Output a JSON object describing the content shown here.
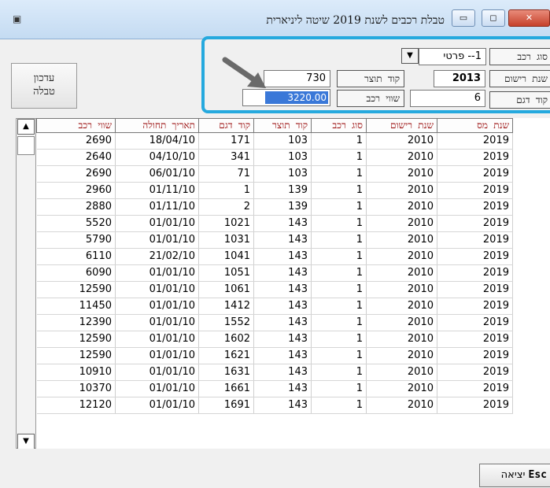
{
  "window": {
    "title": "טבלת רכבים לשנת 2019 שיטה ליניארית",
    "icon": "app-icon",
    "min_label": "▭",
    "max_label": "◻",
    "close_label": "✕"
  },
  "toolbar": {
    "refresh_label": "עדכון\nטבלה",
    "esc_label_key": "Esc",
    "esc_label_text": "יציאה"
  },
  "form": {
    "car_type_label": "סוג רכב",
    "car_type_value": "1-- פרטי",
    "reg_year_label": "שנת רישום",
    "reg_year_value": "2013",
    "model_code_label": "קוד דגם",
    "model_code_value": "6",
    "manufacturer_label": "קוד תוצר",
    "manufacturer_value": "730",
    "car_value_label": "שווי רכב",
    "car_value_value": "3220.00"
  },
  "table": {
    "headers": [
      "שווי רכב",
      "תאריך תחולה",
      "קוד דגם",
      "קוד תוצר",
      "סוג רכב",
      "שנת רישום",
      "שנת מס"
    ],
    "rows": [
      [
        "2690",
        "18/04/10",
        "171",
        "103",
        "1",
        "2010",
        "2019"
      ],
      [
        "2640",
        "04/10/10",
        "341",
        "103",
        "1",
        "2010",
        "2019"
      ],
      [
        "2690",
        "06/01/10",
        "71",
        "103",
        "1",
        "2010",
        "2019"
      ],
      [
        "2960",
        "01/11/10",
        "1",
        "139",
        "1",
        "2010",
        "2019"
      ],
      [
        "2880",
        "01/11/10",
        "2",
        "139",
        "1",
        "2010",
        "2019"
      ],
      [
        "5520",
        "01/01/10",
        "1021",
        "143",
        "1",
        "2010",
        "2019"
      ],
      [
        "5790",
        "01/01/10",
        "1031",
        "143",
        "1",
        "2010",
        "2019"
      ],
      [
        "6110",
        "21/02/10",
        "1041",
        "143",
        "1",
        "2010",
        "2019"
      ],
      [
        "6090",
        "01/01/10",
        "1051",
        "143",
        "1",
        "2010",
        "2019"
      ],
      [
        "12590",
        "01/01/10",
        "1061",
        "143",
        "1",
        "2010",
        "2019"
      ],
      [
        "11450",
        "01/01/10",
        "1412",
        "143",
        "1",
        "2010",
        "2019"
      ],
      [
        "12390",
        "01/01/10",
        "1552",
        "143",
        "1",
        "2010",
        "2019"
      ],
      [
        "12590",
        "01/01/10",
        "1602",
        "143",
        "1",
        "2010",
        "2019"
      ],
      [
        "12590",
        "01/01/10",
        "1621",
        "143",
        "1",
        "2010",
        "2019"
      ],
      [
        "10910",
        "01/01/10",
        "1631",
        "143",
        "1",
        "2010",
        "2019"
      ],
      [
        "10370",
        "01/01/10",
        "1661",
        "143",
        "1",
        "2010",
        "2019"
      ],
      [
        "12120",
        "01/01/10",
        "1691",
        "143",
        "1",
        "2010",
        "2019"
      ]
    ]
  },
  "colors": {
    "highlight": "#25a9de",
    "header_text": "#9b1010",
    "selection": "#3a78d8"
  }
}
